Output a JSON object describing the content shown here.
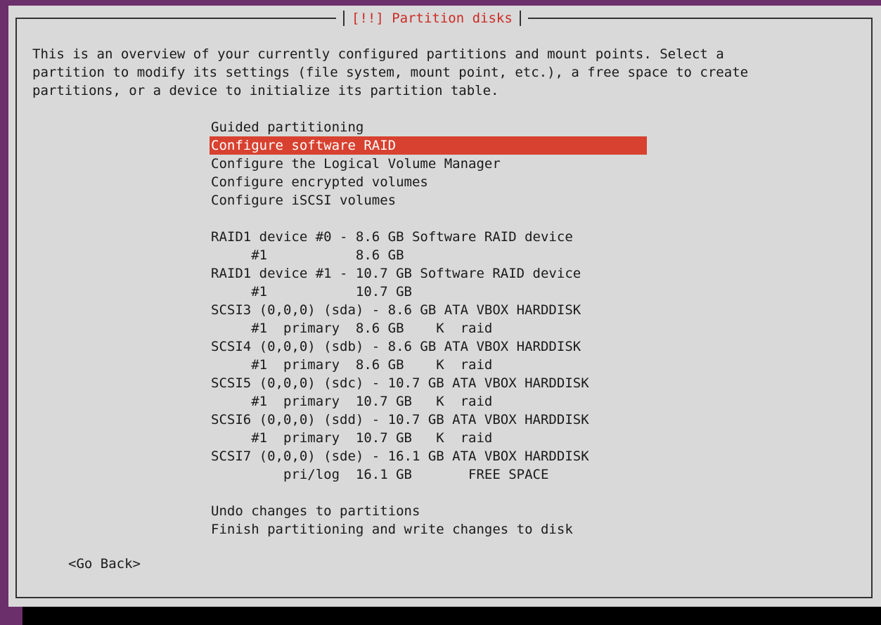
{
  "dialog": {
    "title": "[!!] Partition disks",
    "intro": "This is an overview of your currently configured partitions and mount points. Select a\npartition to modify its settings (file system, mount point, etc.), a free space to create\npartitions, or a device to initialize its partition table."
  },
  "menu": {
    "actions": [
      "Guided partitioning",
      "Configure software RAID",
      "Configure the Logical Volume Manager",
      "Configure encrypted volumes",
      "Configure iSCSI volumes"
    ],
    "selected_index": 1,
    "devices": [
      "RAID1 device #0 - 8.6 GB Software RAID device",
      "     #1           8.6 GB",
      "RAID1 device #1 - 10.7 GB Software RAID device",
      "     #1           10.7 GB",
      "SCSI3 (0,0,0) (sda) - 8.6 GB ATA VBOX HARDDISK",
      "     #1  primary  8.6 GB    K  raid",
      "SCSI4 (0,0,0) (sdb) - 8.6 GB ATA VBOX HARDDISK",
      "     #1  primary  8.6 GB    K  raid",
      "SCSI5 (0,0,0) (sdc) - 10.7 GB ATA VBOX HARDDISK",
      "     #1  primary  10.7 GB   K  raid",
      "SCSI6 (0,0,0) (sdd) - 10.7 GB ATA VBOX HARDDISK",
      "     #1  primary  10.7 GB   K  raid",
      "SCSI7 (0,0,0) (sde) - 16.1 GB ATA VBOX HARDDISK",
      "         pri/log  16.1 GB       FREE SPACE"
    ],
    "finish": [
      "Undo changes to partitions",
      "Finish partitioning and write changes to disk"
    ]
  },
  "buttons": {
    "go_back": "<Go Back>"
  },
  "colors": {
    "desktop": "#6b2f6b",
    "dialog_bg": "#d9d9d9",
    "title": "#cc2a24",
    "highlight": "#d8412f"
  }
}
